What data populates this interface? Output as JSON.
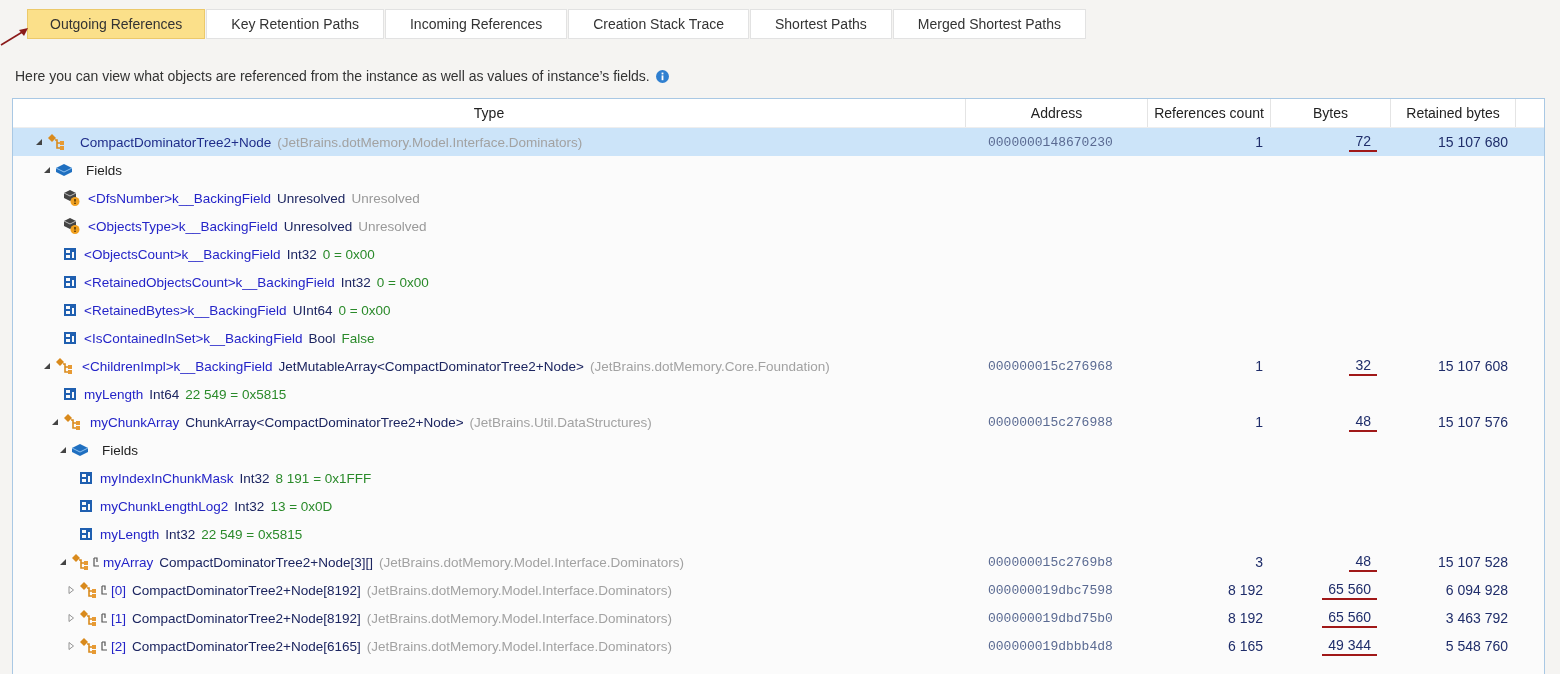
{
  "tabs": [
    {
      "label": "Outgoing References",
      "selected": true
    },
    {
      "label": "Key Retention Paths",
      "selected": false
    },
    {
      "label": "Incoming References",
      "selected": false
    },
    {
      "label": "Creation Stack Trace",
      "selected": false
    },
    {
      "label": "Shortest Paths",
      "selected": false
    },
    {
      "label": "Merged Shortest Paths",
      "selected": false
    }
  ],
  "description": "Here you can view what objects are referenced from the instance as well as values of instance’s fields.",
  "table": {
    "columns": [
      "Type",
      "Address",
      "References count",
      "Bytes",
      "Retained bytes"
    ],
    "rows": [
      {
        "kind": "object",
        "selected": true,
        "expanded": true,
        "type": "CompactDominatorTree2+Node",
        "namespace": "(JetBrains.dotMemory.Model.Interface.Dominators)",
        "address": "0000000148670230",
        "refs": "1",
        "bytes": "72",
        "retained": "15 107 680",
        "children": [
          {
            "kind": "group",
            "selected": false,
            "expanded": true,
            "label": "Fields",
            "children": [
              {
                "kind": "unresolved",
                "selected": false,
                "name": "<DfsNumber>k__BackingField",
                "type": "Unresolved",
                "value": "Unresolved"
              },
              {
                "kind": "unresolved",
                "selected": false,
                "name": "<ObjectsType>k__BackingField",
                "type": "Unresolved",
                "value": "Unresolved"
              },
              {
                "kind": "field",
                "selected": false,
                "name": "<ObjectsCount>k__BackingField",
                "type": "Int32",
                "value": "0 = 0x00"
              },
              {
                "kind": "field",
                "selected": false,
                "name": "<RetainedObjectsCount>k__BackingField",
                "type": "Int32",
                "value": "0 = 0x00"
              },
              {
                "kind": "field",
                "selected": false,
                "name": "<RetainedBytes>k__BackingField",
                "type": "UInt64",
                "value": "0 = 0x00"
              },
              {
                "kind": "field",
                "selected": false,
                "name": "<IsContainedInSet>k__BackingField",
                "type": "Bool",
                "value": "False"
              }
            ]
          },
          {
            "kind": "object",
            "selected": false,
            "expanded": true,
            "name": "<ChildrenImpl>k__BackingField",
            "type": "JetMutableArray<CompactDominatorTree2+Node>",
            "namespace": "(JetBrains.dotMemory.Core.Foundation)",
            "address": "000000015c276968",
            "refs": "1",
            "bytes": "32",
            "retained": "15 107 608",
            "children": [
              {
                "kind": "field",
                "selected": false,
                "name": "myLength",
                "type": "Int64",
                "value": "22 549 = 0x5815"
              },
              {
                "kind": "object",
                "selected": false,
                "expanded": true,
                "name": "myChunkArray",
                "type": "ChunkArray<CompactDominatorTree2+Node>",
                "namespace": "(JetBrains.Util.DataStructures)",
                "address": "000000015c276988",
                "refs": "1",
                "bytes": "48",
                "retained": "15 107 576",
                "children": [
                  {
                    "kind": "group",
                    "selected": false,
                    "expanded": true,
                    "label": "Fields",
                    "children": [
                      {
                        "kind": "field",
                        "selected": false,
                        "name": "myIndexInChunkMask",
                        "type": "Int32",
                        "value": "8 191 = 0x1FFF"
                      },
                      {
                        "kind": "field",
                        "selected": false,
                        "name": "myChunkLengthLog2",
                        "type": "Int32",
                        "value": "13 = 0x0D"
                      },
                      {
                        "kind": "field",
                        "selected": false,
                        "name": "myLength",
                        "type": "Int32",
                        "value": "22 549 = 0x5815"
                      }
                    ]
                  },
                  {
                    "kind": "element",
                    "selected": false,
                    "expanded": true,
                    "name": "myArray",
                    "type": "CompactDominatorTree2+Node[3][]",
                    "namespace": "(JetBrains.dotMemory.Model.Interface.Dominators)",
                    "address": "000000015c2769b8",
                    "refs": "3",
                    "bytes": "48",
                    "retained": "15 107 528",
                    "children": [
                      {
                        "kind": "element",
                        "selected": false,
                        "expanded": false,
                        "name": "[0]",
                        "type": "CompactDominatorTree2+Node[8192]",
                        "namespace": "(JetBrains.dotMemory.Model.Interface.Dominators)",
                        "address": "000000019dbc7598",
                        "refs": "8 192",
                        "bytes": "65 560",
                        "retained": "6 094 928"
                      },
                      {
                        "kind": "element",
                        "selected": false,
                        "expanded": false,
                        "name": "[1]",
                        "type": "CompactDominatorTree2+Node[8192]",
                        "namespace": "(JetBrains.dotMemory.Model.Interface.Dominators)",
                        "address": "000000019dbd75b0",
                        "refs": "8 192",
                        "bytes": "65 560",
                        "retained": "3 463 792"
                      },
                      {
                        "kind": "element",
                        "selected": false,
                        "expanded": false,
                        "name": "[2]",
                        "type": "CompactDominatorTree2+Node[6165]",
                        "namespace": "(JetBrains.dotMemory.Model.Interface.Dominators)",
                        "address": "000000019dbbb4d8",
                        "refs": "6 165",
                        "bytes": "49 344",
                        "retained": "5 548 760"
                      }
                    ]
                  }
                ]
              }
            ]
          }
        ]
      }
    ]
  }
}
